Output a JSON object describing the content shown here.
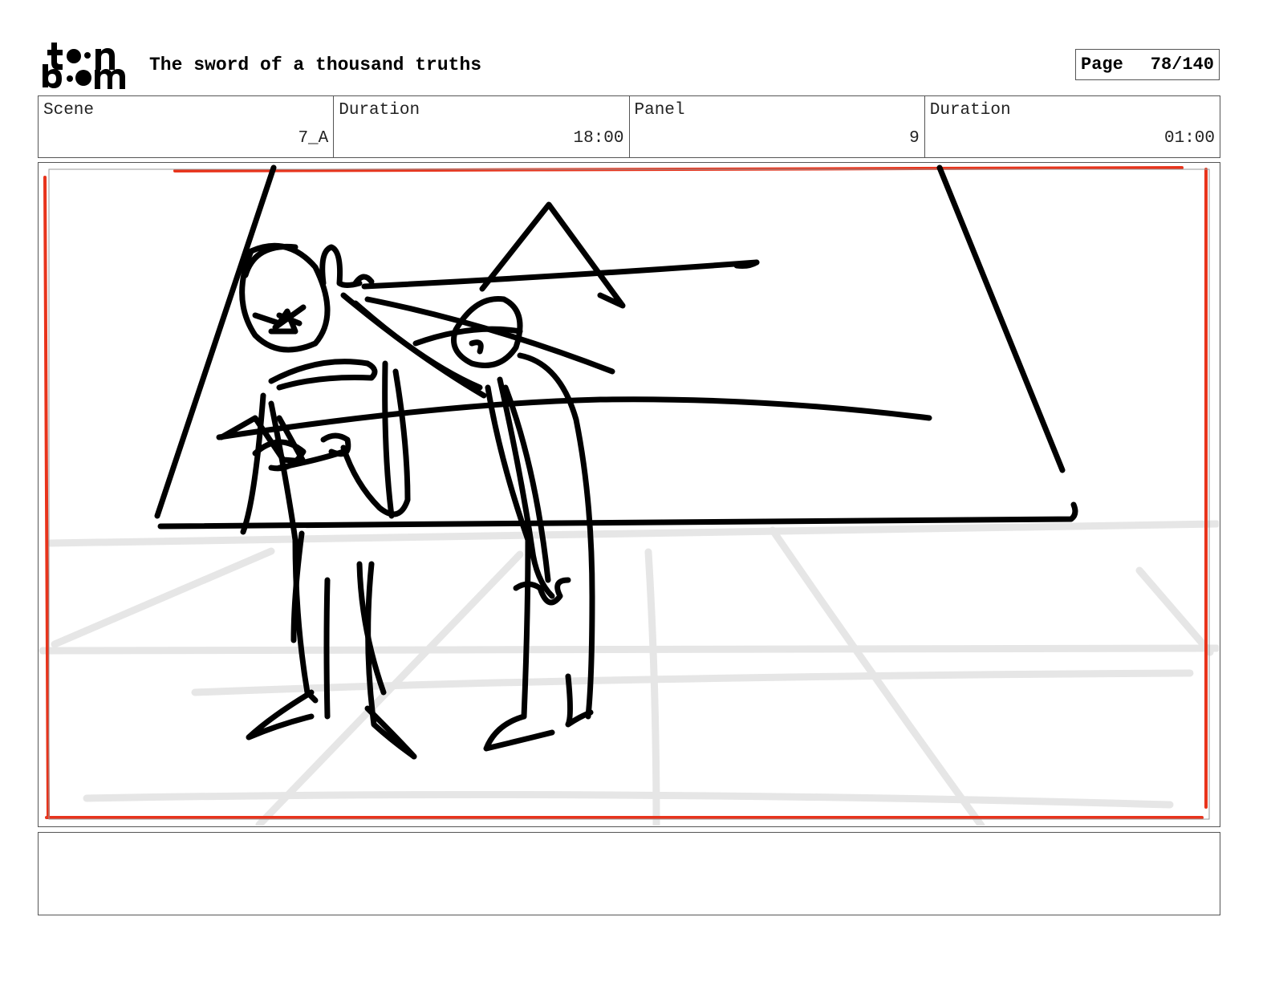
{
  "header": {
    "logo_name": "toon boom",
    "title": "The sword of a thousand truths",
    "page_label": "Page",
    "page_value": "78/140"
  },
  "info": {
    "scene_label": "Scene",
    "scene_value": "7_A",
    "scene_duration_label": "Duration",
    "scene_duration_value": "18:00",
    "panel_label": "Panel",
    "panel_value": "9",
    "panel_duration_label": "Duration",
    "panel_duration_value": "01:00"
  },
  "panel": {
    "image_name": "storyboard-sketch",
    "safe_frame_color": "#e8341c",
    "sketch_color": "#000000",
    "floor_guide_color": "#e6e6e6"
  },
  "notes": {
    "text": ""
  }
}
